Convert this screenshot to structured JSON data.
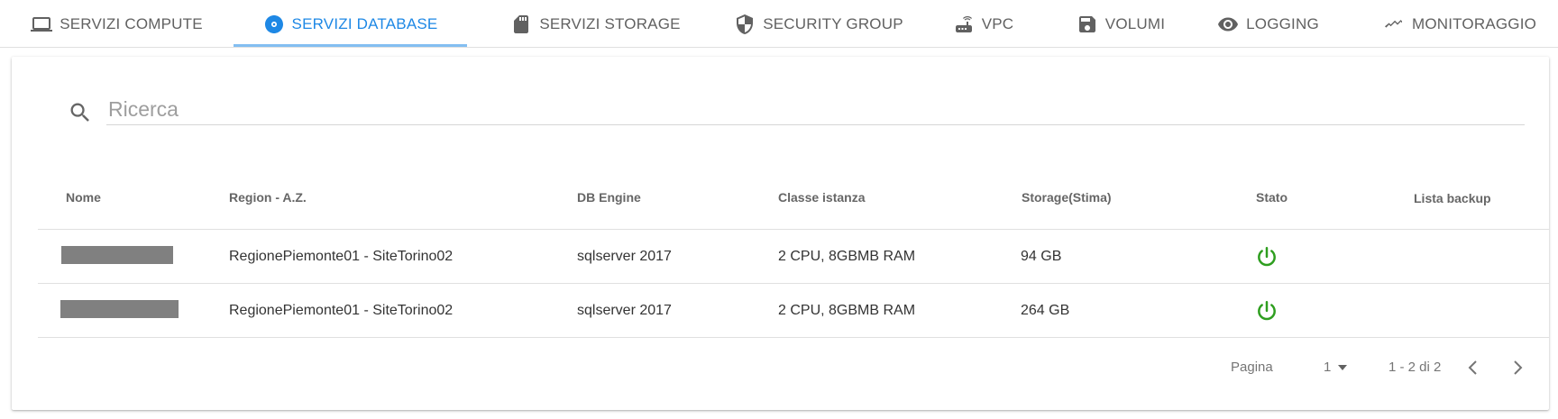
{
  "tabs": [
    {
      "label": "SERVIZI COMPUTE",
      "icon": "laptop-icon"
    },
    {
      "label": "SERVIZI DATABASE",
      "icon": "disc-icon",
      "active": true
    },
    {
      "label": "SERVIZI STORAGE",
      "icon": "sd-card-icon"
    },
    {
      "label": "SECURITY GROUP",
      "icon": "shield-icon"
    },
    {
      "label": "VPC",
      "icon": "router-icon"
    },
    {
      "label": "VOLUMI",
      "icon": "floppy-disk-icon"
    },
    {
      "label": "LOGGING",
      "icon": "eye-icon"
    },
    {
      "label": "MONITORAGGIO",
      "icon": "trending-icon"
    }
  ],
  "colors": {
    "accent": "#1e88e5",
    "status_on": "#2e9e1f",
    "redaction": "#808080"
  },
  "search": {
    "placeholder": "Ricerca",
    "value": ""
  },
  "table": {
    "headers": [
      "Nome",
      "Region - A.Z.",
      "DB Engine",
      "Classe istanza",
      "Storage(Stima)",
      "Stato",
      "Lista backup"
    ],
    "rows": [
      {
        "name": "",
        "region": "RegionePiemonte01 - SiteTorino02",
        "engine": "sqlserver 2017",
        "instance_class": "2 CPU, 8GBMB RAM",
        "storage": "94 GB",
        "status_icon": "power-icon"
      },
      {
        "name": "",
        "region": "RegionePiemonte01 - SiteTorino02",
        "engine": "sqlserver 2017",
        "instance_class": "2 CPU, 8GBMB RAM",
        "storage": "264 GB",
        "status_icon": "power-icon"
      }
    ]
  },
  "pagination": {
    "label": "Pagina",
    "page": "1",
    "range": "1 - 2 di 2"
  }
}
